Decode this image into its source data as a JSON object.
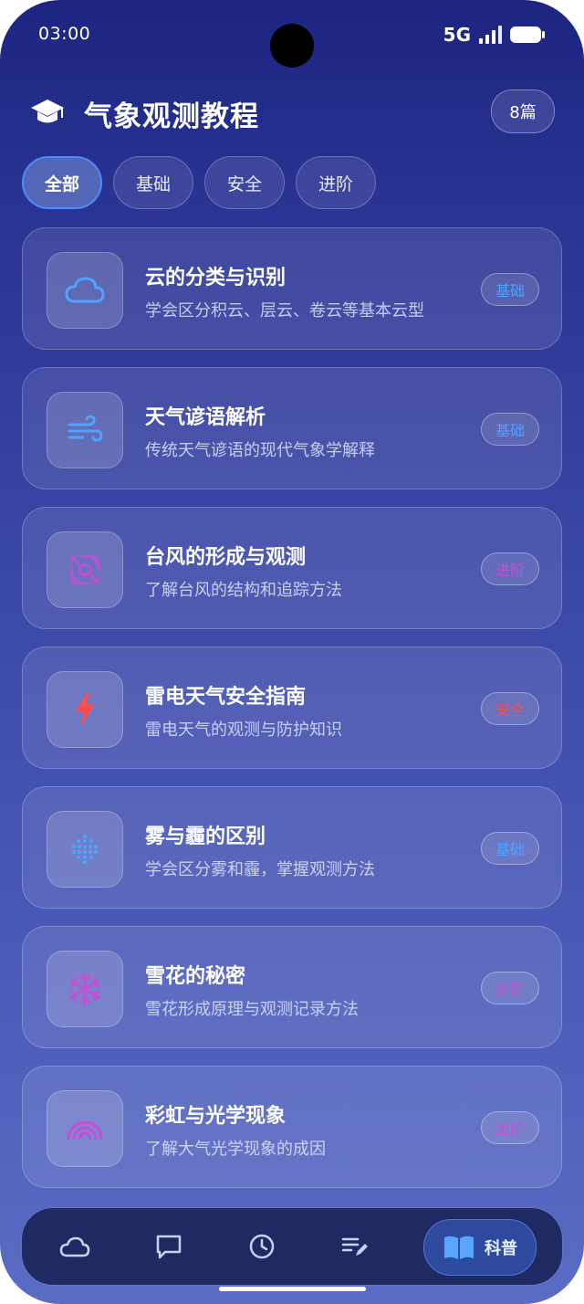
{
  "status_bar": {
    "time": "03:00",
    "network": "5G"
  },
  "header": {
    "title": "气象观测教程",
    "count": "8篇",
    "icon": "graduation-cap-icon"
  },
  "filters": [
    {
      "label": "全部",
      "active": true
    },
    {
      "label": "基础",
      "active": false
    },
    {
      "label": "安全",
      "active": false
    },
    {
      "label": "进阶",
      "active": false
    }
  ],
  "articles": [
    {
      "title": "云的分类与识别",
      "subtitle": "学会区分积云、层云、卷云等基本云型",
      "tag": "基础",
      "tag_color": "#4fa3ff",
      "icon": "cloud-icon",
      "icon_color": "#4fa3ff"
    },
    {
      "title": "天气谚语解析",
      "subtitle": "传统天气谚语的现代气象学解释",
      "tag": "基础",
      "tag_color": "#4fa3ff",
      "icon": "wind-icon",
      "icon_color": "#4fa3ff"
    },
    {
      "title": "台风的形成与观测",
      "subtitle": "了解台风的结构和追踪方法",
      "tag": "进阶",
      "tag_color": "#c34fd6",
      "icon": "typhoon-icon",
      "icon_color": "#c34fd6"
    },
    {
      "title": "雷电天气安全指南",
      "subtitle": "雷电天气的观测与防护知识",
      "tag": "安全",
      "tag_color": "#ff4d4d",
      "icon": "lightning-icon",
      "icon_color": "#ff4d4d"
    },
    {
      "title": "雾与霾的区别",
      "subtitle": "学会区分雾和霾，掌握观测方法",
      "tag": "基础",
      "tag_color": "#4fa3ff",
      "icon": "fog-dots-icon",
      "icon_color": "#4fa3ff"
    },
    {
      "title": "雪花的秘密",
      "subtitle": "雪花形成原理与观测记录方法",
      "tag": "进阶",
      "tag_color": "#c34fd6",
      "icon": "snowflake-icon",
      "icon_color": "#c34fd6"
    },
    {
      "title": "彩虹与光学现象",
      "subtitle": "了解大气光学现象的成因",
      "tag": "进阶",
      "tag_color": "#c34fd6",
      "icon": "rainbow-icon",
      "icon_color": "#c34fd6"
    }
  ],
  "bottom_nav": {
    "items": [
      "cloud-icon",
      "chat-icon",
      "clock-icon",
      "edit-list-icon"
    ],
    "active_label": "科普",
    "active_icon": "book-icon"
  }
}
